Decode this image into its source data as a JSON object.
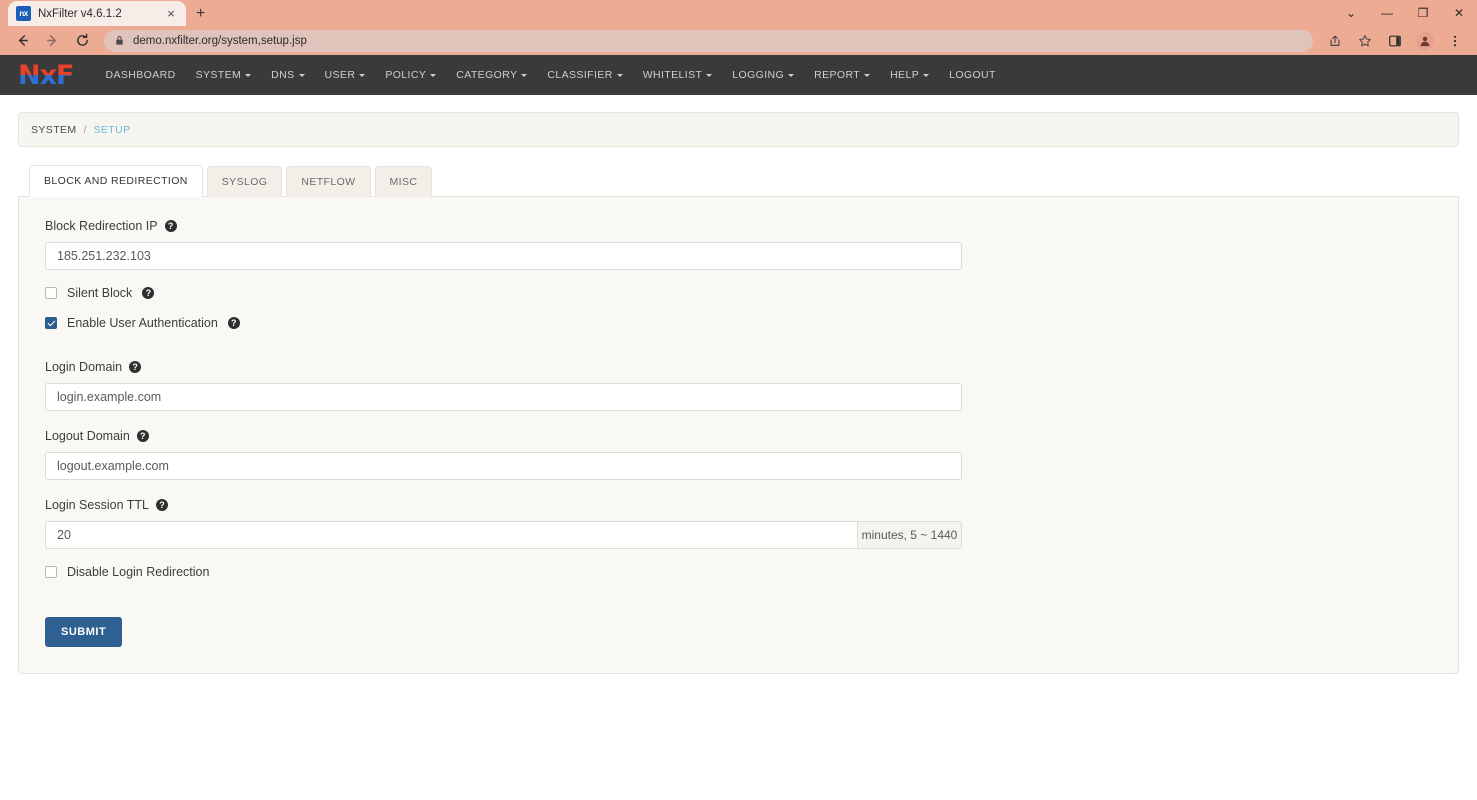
{
  "browser": {
    "tab": {
      "title": "NxFilter v4.6.1.2",
      "favicon_label": "nx",
      "close_icon": "×"
    },
    "newtab_icon": "+",
    "window_controls": [
      {
        "name": "chevron-down-icon",
        "glyph": "⌄"
      },
      {
        "name": "minimize-icon",
        "glyph": "—"
      },
      {
        "name": "maximize-icon",
        "glyph": "❐"
      },
      {
        "name": "close-icon",
        "glyph": "✕"
      }
    ],
    "nav_back_icon": "←",
    "nav_forward_icon": "→",
    "reload_icon": "↻",
    "url": "demo.nxfilter.org/system,setup.jsp",
    "lock_icon": "🔒"
  },
  "app": {
    "logo": "NxF",
    "nav": [
      {
        "label": "DASHBOARD",
        "dropdown": false
      },
      {
        "label": "SYSTEM",
        "dropdown": true
      },
      {
        "label": "DNS",
        "dropdown": true
      },
      {
        "label": "USER",
        "dropdown": true
      },
      {
        "label": "POLICY",
        "dropdown": true
      },
      {
        "label": "CATEGORY",
        "dropdown": true
      },
      {
        "label": "CLASSIFIER",
        "dropdown": true
      },
      {
        "label": "WHITELIST",
        "dropdown": true
      },
      {
        "label": "LOGGING",
        "dropdown": true
      },
      {
        "label": "REPORT",
        "dropdown": true
      },
      {
        "label": "HELP",
        "dropdown": true
      },
      {
        "label": "LOGOUT",
        "dropdown": false
      }
    ],
    "breadcrumb": {
      "parent": "SYSTEM",
      "separator": "/",
      "current": "SETUP"
    },
    "tabs": [
      {
        "label": "BLOCK AND REDIRECTION",
        "active": true
      },
      {
        "label": "SYSLOG",
        "active": false
      },
      {
        "label": "NETFLOW",
        "active": false
      },
      {
        "label": "MISC",
        "active": false
      }
    ],
    "form": {
      "block_redirection_ip": {
        "label": "Block Redirection IP",
        "value": "185.251.232.103",
        "has_help": true
      },
      "silent_block": {
        "label": "Silent Block",
        "checked": false,
        "has_help": true
      },
      "enable_user_authentication": {
        "label": "Enable User Authentication",
        "checked": true,
        "has_help": true
      },
      "login_domain": {
        "label": "Login Domain",
        "value": "login.example.com",
        "has_help": true
      },
      "logout_domain": {
        "label": "Logout Domain",
        "value": "logout.example.com",
        "has_help": true
      },
      "login_session_ttl": {
        "label": "Login Session TTL",
        "value": "20",
        "addon": "minutes, 5 ~ 1440",
        "has_help": true
      },
      "disable_login_redirection": {
        "label": "Disable Login Redirection",
        "checked": false,
        "has_help": false
      },
      "submit_label": "SUBMIT"
    }
  },
  "colors": {
    "navbar": "#3a3a3a",
    "accent_blue": "#2f6092",
    "logo_red": "#e8422a",
    "logo_blue": "#2f6fd0",
    "breadcrumb_link": "#6fb8de",
    "card_bg": "#faf8f4",
    "chrome_bg": "#edab94"
  }
}
